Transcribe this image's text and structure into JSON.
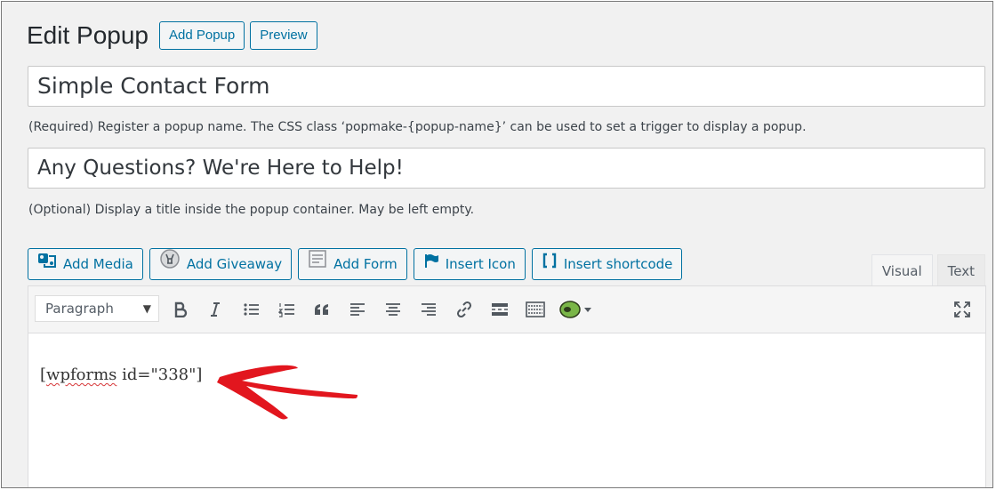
{
  "header": {
    "title": "Edit Popup",
    "add_popup": "Add Popup",
    "preview": "Preview"
  },
  "popup_name": {
    "value": "Simple Contact Form",
    "help": "(Required) Register a popup name. The CSS class ‘popmake-{popup-name}’ can be used to set a trigger to display a popup."
  },
  "popup_title": {
    "value": "Any Questions? We're Here to Help!",
    "help": "(Optional) Display a title inside the popup container. May be left empty."
  },
  "media_buttons": {
    "add_media": "Add Media",
    "add_giveaway": "Add Giveaway",
    "add_form": "Add Form",
    "insert_icon": "Insert Icon",
    "insert_shortcode": "Insert shortcode"
  },
  "editor_tabs": {
    "visual": "Visual",
    "text": "Text"
  },
  "toolbar": {
    "format": "Paragraph"
  },
  "content": {
    "shortcode_open": "[",
    "shortcode_word": "wpforms",
    "shortcode_rest": " id=\"338\"]"
  },
  "colors": {
    "accent": "#0071a1",
    "arrow": "#e2161e",
    "background": "#f1f1f1"
  }
}
